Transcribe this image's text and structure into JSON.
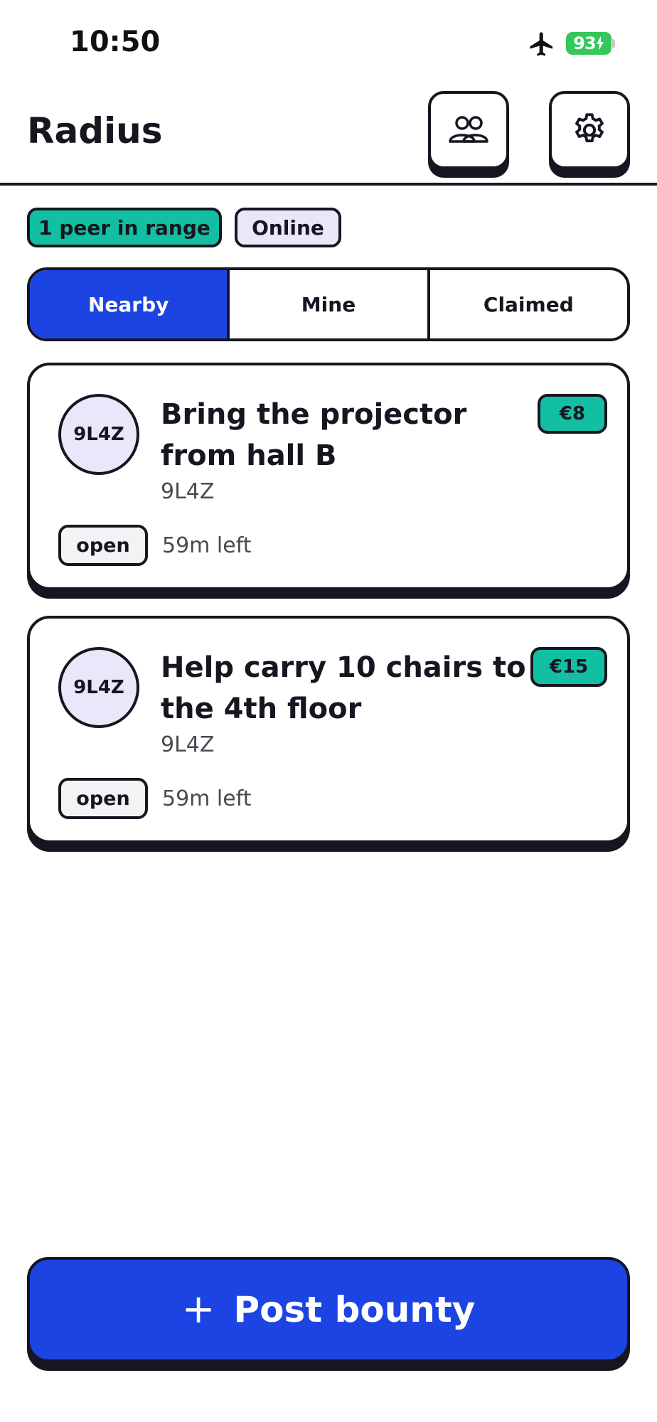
{
  "status_bar": {
    "time": "10:50",
    "battery": "93",
    "airplane_icon": "airplane-icon",
    "battery_color": "#34c759"
  },
  "header": {
    "title": "Radius",
    "people_icon": "people-icon",
    "settings_icon": "gear-icon"
  },
  "chips": {
    "peers": "1 peer in range",
    "online": "Online"
  },
  "tabs": [
    {
      "label": "Nearby",
      "active": true
    },
    {
      "label": "Mine",
      "active": false
    },
    {
      "label": "Claimed",
      "active": false
    }
  ],
  "bounties": [
    {
      "avatar": "9L4Z",
      "title": "Bring the projector from hall B",
      "poster": "9L4Z",
      "reward": "€8",
      "status": "open",
      "time_left": "59m left"
    },
    {
      "avatar": "9L4Z",
      "title": "Help carry 10 chairs to the 4th floor",
      "poster": "9L4Z",
      "reward": "€15",
      "status": "open",
      "time_left": "59m left"
    }
  ],
  "post_button": {
    "icon": "+",
    "label": "Post bounty"
  },
  "colors": {
    "accent_blue": "#1c44e3",
    "teal": "#12bfa2",
    "lavender": "#e9e8fb",
    "ink": "#161620"
  }
}
